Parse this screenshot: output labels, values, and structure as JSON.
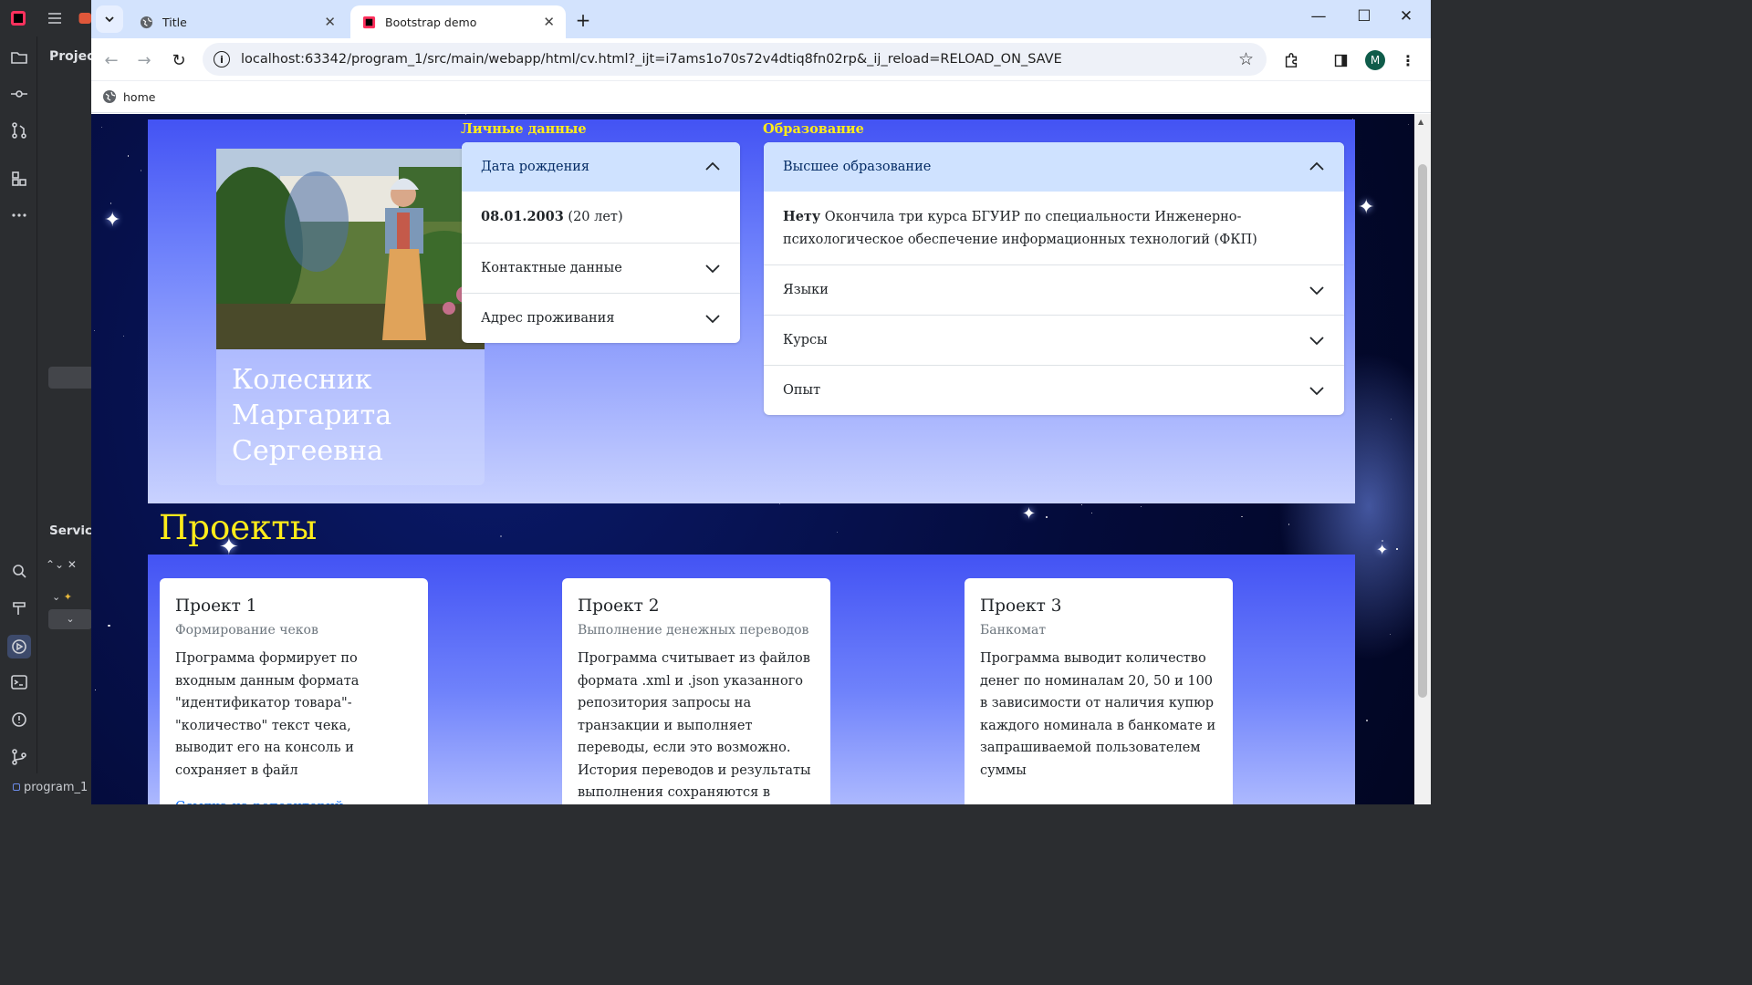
{
  "ide": {
    "project_label": "Projec",
    "services_label": "Servic",
    "footer_project": "program_1"
  },
  "browser": {
    "tabs": [
      {
        "title": "Title",
        "active": false
      },
      {
        "title": "Bootstrap demo",
        "active": true
      }
    ],
    "url": "localhost:63342/program_1/src/main/webapp/html/cv.html?_ijt=i7ams1o70s72v4dtiq8fn02rp&_ij_reload=RELOAD_ON_SAVE",
    "profile_initial": "M",
    "bookmark": "home"
  },
  "page": {
    "name_lines": [
      "Колесник",
      "Маргарита",
      "Сергеевна"
    ],
    "personal": {
      "label": "Личные данные",
      "items": [
        {
          "title": "Дата рождения",
          "open": true,
          "body_bold": "08.01.2003",
          "body": " (20 лет)"
        },
        {
          "title": "Контактные данные",
          "open": false
        },
        {
          "title": "Адрес проживания",
          "open": false
        }
      ]
    },
    "education": {
      "label": "Образование",
      "items": [
        {
          "title": "Высшее образование",
          "open": true,
          "body_bold": "Нету",
          "body": " Окончила три курса БГУИР по специальности Инженерно-психологическое обеспечение информационных технологий (ФКП)"
        },
        {
          "title": "Языки",
          "open": false
        },
        {
          "title": "Курсы",
          "open": false
        },
        {
          "title": "Опыт",
          "open": false
        }
      ]
    },
    "projects_title": "Проекты",
    "projects": [
      {
        "title": "Проект 1",
        "subtitle": "Формирование чеков",
        "text": "Программа формирует по входным данным формата \"идентификатор товара\"-\"количество\" текст чека, выводит его на консоль и сохраняет в файл",
        "link": "Ссылка на репозиторий"
      },
      {
        "title": "Проект 2",
        "subtitle": "Выполнение денежных переводов",
        "text": "Программа считывает из файлов формата .xml и .json указанного репозитория запросы на транзакции и выполняет переводы, если это возможно. История переводов и результаты выполнения сохраняются в",
        "link": ""
      },
      {
        "title": "Проект 3",
        "subtitle": "Банкомат",
        "text": "Программа выводит количество денег по номиналам 20, 50 и 100 в зависимости от наличия купюр каждого номинала в банкомате и запрашиваемой пользователем суммы",
        "link": ""
      }
    ]
  },
  "colors": {
    "accent_yellow": "#ffec1a",
    "section_blue": "#4353f4",
    "accordion_open": "#cfe2ff",
    "link": "#0d6efd"
  }
}
